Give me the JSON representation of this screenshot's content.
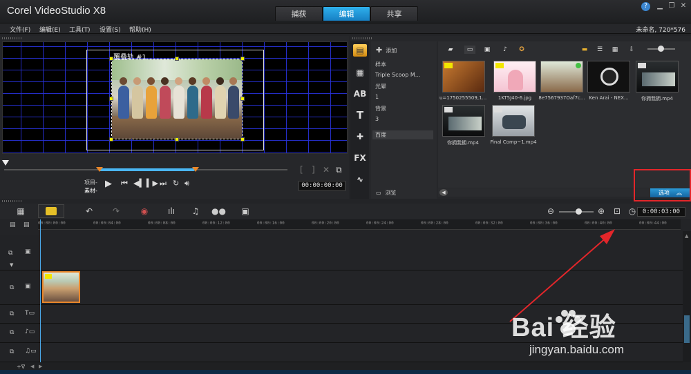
{
  "titlebar": {
    "app_title": "Corel VideoStudio X8",
    "tabs": [
      "捕获",
      "编辑",
      "共享"
    ],
    "active_tab": "编辑",
    "help": "?"
  },
  "menubar": {
    "items": [
      "文件(F)",
      "编辑(E)",
      "工具(T)",
      "设置(S)",
      "帮助(H)"
    ],
    "project_info": "未命名, 720*576"
  },
  "preview": {
    "overlay_label": "覆叠轨 #1",
    "project_label": "项目-",
    "clip_label": "素材-",
    "timecode": "00:00:00:00"
  },
  "library": {
    "add_label": "添加",
    "browse_label": "浏览",
    "folders": [
      "样本",
      "Triple Scoop M...",
      "光晕",
      "1",
      "背景",
      "3",
      "百度"
    ],
    "selected_folder": "百度",
    "thumbnails": [
      {
        "caption": "u=1750255509,1..."
      },
      {
        "caption": "1KT5J40-6.jpg"
      },
      {
        "caption": "8e7567937Oaf7c..."
      },
      {
        "caption": "Ken Arai - NEX..."
      },
      {
        "caption": "你拥我拥.mp4"
      },
      {
        "caption": "你拥我拥.mp4"
      },
      {
        "caption": "Final Comp~1.mp4"
      }
    ],
    "options_label": "选项"
  },
  "timeline": {
    "duration": "0:00:03:00",
    "ruler": [
      "00:00:00:00",
      "00:00:04:00",
      "00:00:08:00",
      "00:00:12:00",
      "00:00:16:00",
      "00:00:20:00",
      "00:00:24:00",
      "00:00:28:00",
      "00:00:32:00",
      "00:00:36:00",
      "00:00:40:00",
      "00:00:44:00"
    ]
  },
  "watermark": {
    "text": "Bai 经验",
    "url": "jingyan.baidu.com"
  },
  "colors": {
    "accent": "#1e96dc",
    "highlight_box": "#e3262a",
    "annotation_arrow": "#e3262a",
    "clip_border": "#e8862a",
    "grid": "#2832dc"
  }
}
